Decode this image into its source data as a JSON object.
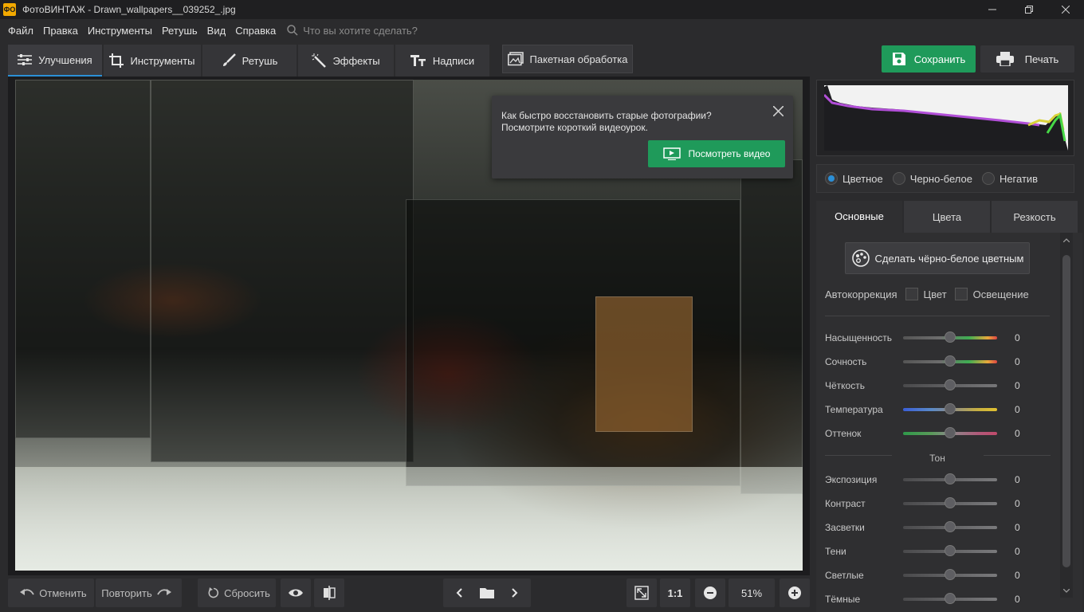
{
  "window": {
    "app_badge": "ФО",
    "title": "ФотоВИНТАЖ - Drawn_wallpapers__039252_.jpg"
  },
  "menu": {
    "items": [
      "Файл",
      "Правка",
      "Инструменты",
      "Ретушь",
      "Вид",
      "Справка"
    ],
    "search_placeholder": "Что вы хотите сделать?"
  },
  "toolbar": {
    "tabs": [
      {
        "label": "Улучшения",
        "icon": "sliders-icon",
        "active": true
      },
      {
        "label": "Инструменты",
        "icon": "crop-icon",
        "active": false
      },
      {
        "label": "Ретушь",
        "icon": "brush-icon",
        "active": false
      },
      {
        "label": "Эффекты",
        "icon": "magic-wand-icon",
        "active": false
      },
      {
        "label": "Надписи",
        "icon": "text-icon",
        "active": false
      }
    ],
    "batch_label": "Пакетная обработка",
    "save_label": "Сохранить",
    "print_label": "Печать"
  },
  "popup": {
    "text_line1": "Как быстро восстановить старые фотографии?",
    "text_line2": "Посмотрите короткий видеоурок.",
    "button_label": "Посмотреть видео"
  },
  "panel": {
    "modes": [
      {
        "label": "Цветное",
        "selected": true
      },
      {
        "label": "Черно-белое",
        "selected": false
      },
      {
        "label": "Негатив",
        "selected": false
      }
    ],
    "tabs": [
      {
        "label": "Основные",
        "active": true
      },
      {
        "label": "Цвета",
        "active": false
      },
      {
        "label": "Резкость",
        "active": false
      }
    ],
    "bw_button": "Сделать чёрно-белое цветным",
    "auto_label": "Автокоррекция",
    "auto_color": "Цвет",
    "auto_light": "Освещение",
    "sliders_color": [
      {
        "label": "Насыщенность",
        "value": "0",
        "level": 0.5
      },
      {
        "label": "Сочность",
        "value": "0",
        "level": 0.5
      },
      {
        "label": "Чёткость",
        "value": "0",
        "level": 0.5
      },
      {
        "label": "Температура",
        "value": "0",
        "level": 0.5
      },
      {
        "label": "Оттенок",
        "value": "0",
        "level": 0.5
      }
    ],
    "tone_title": "Тон",
    "sliders_tone": [
      {
        "label": "Экспозиция",
        "value": "0",
        "level": 0.5
      },
      {
        "label": "Контраст",
        "value": "0",
        "level": 0.5
      },
      {
        "label": "Засветки",
        "value": "0",
        "level": 0.5
      },
      {
        "label": "Тени",
        "value": "0",
        "level": 0.5
      },
      {
        "label": "Светлые",
        "value": "0",
        "level": 0.5
      },
      {
        "label": "Тёмные",
        "value": "0",
        "level": 0.5
      }
    ]
  },
  "bottom": {
    "undo_label": "Отменить",
    "redo_label": "Повторить",
    "reset_label": "Сбросить",
    "ratio_label": "1:1",
    "zoom_value": "51%"
  },
  "colors": {
    "accent": "#2b8fd6",
    "save_green": "#1f9a5a"
  }
}
